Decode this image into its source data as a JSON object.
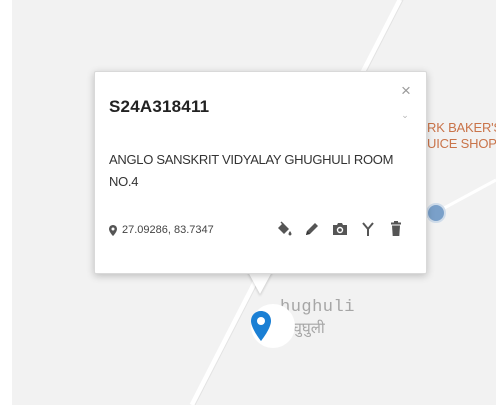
{
  "map": {
    "poi_label_line1": "RK BAKER'S",
    "poi_label_line2": "UICE SHOP",
    "place_label": "hughuli",
    "place_label_local": "घुघुली",
    "road_color": "#ffffff",
    "background_color": "#f2f2f2"
  },
  "popup": {
    "title": "S24A318411",
    "address_line1": "ANGLO SANSKRIT VIDYALAY GHUGHULI ROOM",
    "address_line2": "NO.4",
    "coordinates": "27.09286, 83.7347",
    "close_symbol": "×",
    "scroll_symbol": "⌄",
    "toolbar_icons": [
      "paint-bucket-icon",
      "pencil-icon",
      "camera-icon",
      "route-fork-icon",
      "trash-icon"
    ]
  },
  "marker": {
    "color": "#1a7fd4",
    "icon": "map-pin-icon"
  }
}
